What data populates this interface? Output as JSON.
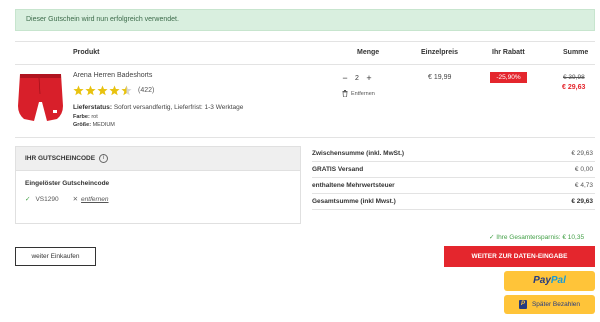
{
  "alert": {
    "text": "Dieser Gutschein wird nun erfolgreich verwendet."
  },
  "table": {
    "headers": {
      "product": "Produkt",
      "quantity": "Menge",
      "unit_price": "Einzelpreis",
      "discount": "Ihr Rabatt",
      "total": "Summe"
    }
  },
  "item": {
    "name": "Arena Herren Badeshorts",
    "rating": 4.5,
    "reviews": "(422)",
    "status_label": "Lieferstatus:",
    "status_value": "Sofort versandfertig, Lieferfrist: 1-3 Werktage",
    "color_label": "Farbe:",
    "color_value": "rot",
    "size_label": "Größe:",
    "size_value": "MEDIUM",
    "qty_minus": "−",
    "qty_value": "2",
    "qty_plus": "+",
    "remove_label": "Entfernen",
    "unit_price": "€ 19,99",
    "discount": "-25,90%",
    "old_price": "€ 39,98",
    "new_price": "€ 29,63",
    "image_icon": "red-swim-shorts",
    "accent_color": "#e4262d"
  },
  "coupon": {
    "title": "IHR GUTSCHEINCODE",
    "info_icon": "i",
    "subtitle": "Eingelöster Gutscheincode",
    "code": "VS1290",
    "remove_link": "entfernen"
  },
  "totals": {
    "rows": [
      {
        "label": "Zwischensumme (inkl. MwSt.)",
        "value": "€ 29,63"
      },
      {
        "label": "GRATIS Versand",
        "value": "€ 0,00"
      },
      {
        "label": "enthaltene Mehrwertsteuer",
        "value": "€ 4,73"
      },
      {
        "label": "Gesamtsumme (inkl Mwst.)",
        "value": "€ 29,63"
      }
    ]
  },
  "savings": "Ihre Gesamtersparnis: € 10,35",
  "buttons": {
    "continue_shopping": "weiter Einkaufen",
    "checkout": "WEITER ZUR DATEN-EINGABE",
    "paypal_part1": "Pay",
    "paypal_part2": "Pal",
    "paypal_later": "Später Bezahlen",
    "paypal_later_icon": "P"
  }
}
